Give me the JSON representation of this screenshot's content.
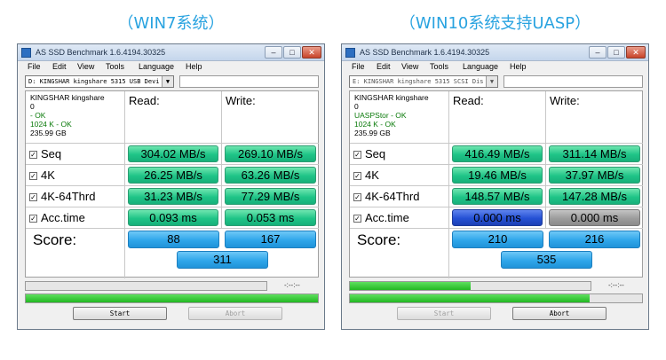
{
  "captions": {
    "left": "（WIN7系统）",
    "right": "（WIN10系统支持UASP）"
  },
  "menu": [
    "File",
    "Edit",
    "View",
    "Tools",
    "Language",
    "Help"
  ],
  "window_title": "AS SSD Benchmark 1.6.4194.30325",
  "headers": {
    "read": "Read:",
    "write": "Write:",
    "score": "Score:"
  },
  "row_labels": [
    "Seq",
    "4K",
    "4K-64Thrd",
    "Acc.time"
  ],
  "start_label": "Start",
  "abort_label": "Abort",
  "time_placeholder": "-:--:--",
  "checkbox_mark": "✓",
  "left": {
    "drive": "D: KINGSHAR kingshare  5315 USB Devi",
    "info": {
      "model": "KINGSHAR kingshare",
      "fw": "0",
      "driver": " - OK",
      "align": "1024 K - OK",
      "size": "235.99 GB"
    },
    "read": [
      "304.02 MB/s",
      "26.25 MB/s",
      "31.23 MB/s",
      "0.093 ms"
    ],
    "write": [
      "269.10 MB/s",
      "63.26 MB/s",
      "77.29 MB/s",
      "0.053 ms"
    ],
    "score": {
      "read": "88",
      "write": "167",
      "total": "311"
    },
    "progress": [
      0.0,
      1.0
    ],
    "start_enabled": true,
    "abort_enabled": false
  },
  "right": {
    "drive": "E: KINGSHAR kingshare  5315 SCSI Dis",
    "info": {
      "model": "KINGSHAR kingshare",
      "fw": "0",
      "driver": "UASPStor - OK",
      "align": "1024 K - OK",
      "size": "235.99 GB"
    },
    "read": [
      "416.49 MB/s",
      "19.46 MB/s",
      "148.57 MB/s",
      "0.000 ms"
    ],
    "write": [
      "311.14 MB/s",
      "37.97 MB/s",
      "147.28 MB/s",
      "0.000 ms"
    ],
    "score": {
      "read": "210",
      "write": "216",
      "total": "535"
    },
    "progress": [
      0.5,
      0.82
    ],
    "start_enabled": false,
    "abort_enabled": true
  },
  "colors": {
    "caption": "#29a3e0",
    "value_green": "#1fc487",
    "acc_read_right": "#2450d4",
    "acc_write_right": "#9c9c9c",
    "score_blue": "#2fa6ea",
    "progress_green": "#22b822"
  }
}
